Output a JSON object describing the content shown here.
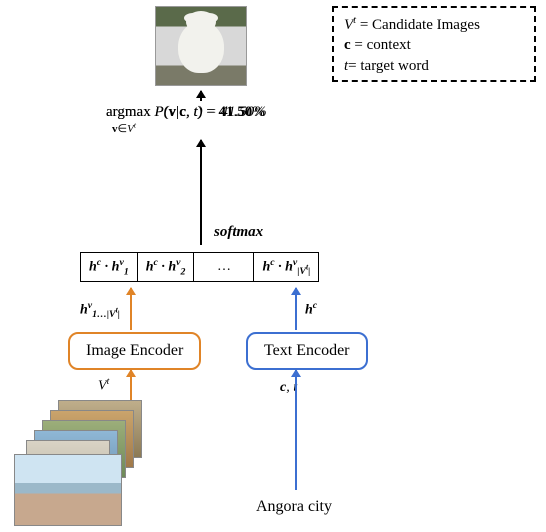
{
  "legend": {
    "line1_lhs": "V",
    "line1_sup": "t",
    "line1_rhs": "= Candidate Images",
    "line2_lhs": "c",
    "line2_rhs": " = context",
    "line3_lhs": "t",
    "line3_rhs": "= target word"
  },
  "argmax": {
    "op": "argmax",
    "sub_pre": "v∈",
    "sub_V": "V",
    "sub_t": "t",
    "prob": "P(v|c, t) = 41.50%"
  },
  "softmax": "softmax",
  "cells": {
    "c1": "h",
    "c1_sup": "c",
    "dot": " · ",
    "hv": "h",
    "s1": "1",
    "s2": "2",
    "ellipsis": "…",
    "sV": "|V",
    "sVt": "t",
    "sVend": "|",
    "vsup": "v"
  },
  "h_label": {
    "pre": "h",
    "sub": "1…|V",
    "subt": "t",
    "subend": "|",
    "sup": "v"
  },
  "hc": {
    "pre": "h",
    "sup": "c"
  },
  "encoders": {
    "image": "Image Encoder",
    "text": "Text Encoder"
  },
  "below": {
    "Vt_V": "V",
    "Vt_t": "t",
    "ct": "c, t"
  },
  "input_text": "Angora city"
}
